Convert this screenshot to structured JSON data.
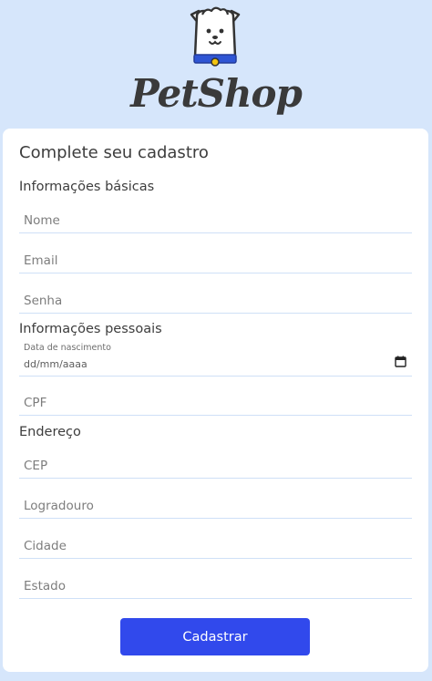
{
  "brand": {
    "name": "PetShop"
  },
  "form": {
    "title": "Complete seu cadastro",
    "sections": {
      "basic": "Informações básicas",
      "personal": "Informações pessoais",
      "address": "Endereço"
    },
    "fields": {
      "nome": "Nome",
      "email": "Email",
      "senha": "Senha",
      "data_label": "Data de nascimento",
      "data_value": "dd/mm/aaaa",
      "cpf": "CPF",
      "cep": "CEP",
      "logradouro": "Logradouro",
      "cidade": "Cidade",
      "estado": "Estado"
    },
    "submit_label": "Cadastrar"
  },
  "colors": {
    "background": "#d6e6fb",
    "primary_button": "#3149ec",
    "field_underline": "#cfe0f7",
    "collar": "#2f55d4",
    "collar_tag": "#f2c40f"
  },
  "icons": [
    "dog-logo-icon",
    "calendar-icon"
  ]
}
